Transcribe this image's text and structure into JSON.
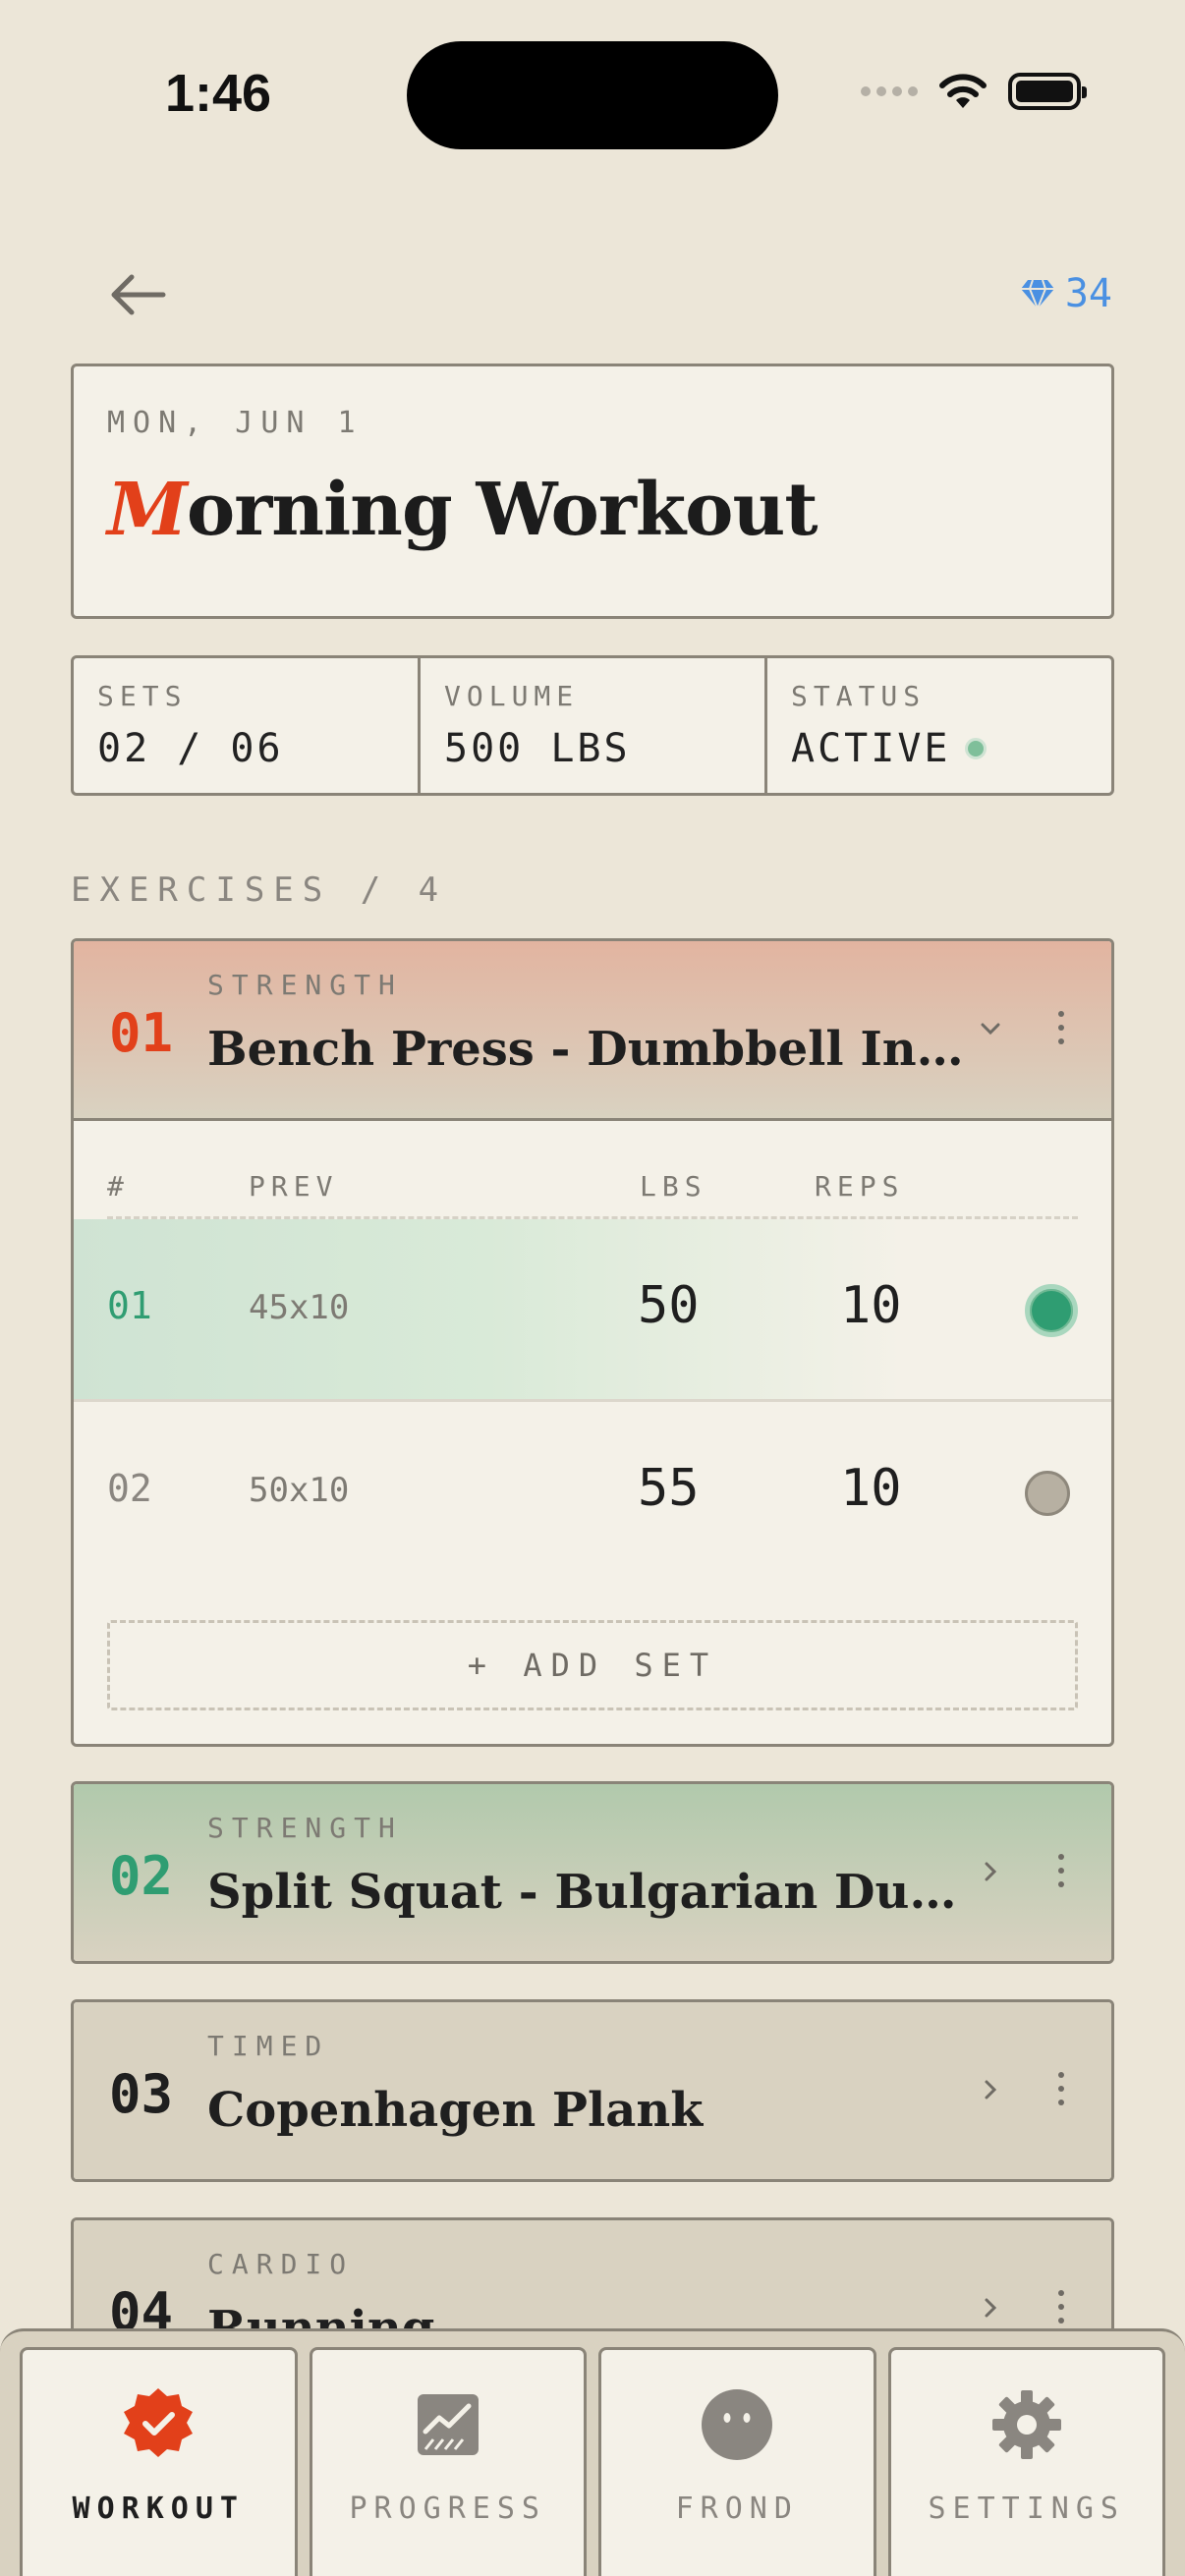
{
  "status_bar": {
    "time": "1:46"
  },
  "header": {
    "gems": "34"
  },
  "workout": {
    "date": "MON, JUN 1",
    "title_initial": "M",
    "title_rest": "orning Workout"
  },
  "stats": [
    {
      "label": "SETS",
      "value": "02 / 06"
    },
    {
      "label": "VOLUME",
      "value": "500 LBS"
    },
    {
      "label": "STATUS",
      "value": "ACTIVE"
    }
  ],
  "exercises_header": "EXERCISES / 4",
  "columns": {
    "idx": "#",
    "prev": "PREV",
    "lbs": "LBS",
    "reps": "REPS"
  },
  "exercises": [
    {
      "num": "01",
      "category": "STRENGTH",
      "name": "Bench Press - Dumbbell Incline",
      "sets": [
        {
          "idx": "01",
          "prev": "45x10",
          "lbs": "50",
          "reps": "10"
        },
        {
          "idx": "02",
          "prev": "50x10",
          "lbs": "55",
          "reps": "10"
        }
      ],
      "add_set": "+ ADD SET"
    },
    {
      "num": "02",
      "category": "STRENGTH",
      "name": "Split Squat - Bulgarian Dumbb…"
    },
    {
      "num": "03",
      "category": "TIMED",
      "name": "Copenhagen Plank"
    },
    {
      "num": "04",
      "category": "CARDIO",
      "name": "Running"
    }
  ],
  "tabs": [
    {
      "label": "WORKOUT",
      "icon": "workout-badge-icon"
    },
    {
      "label": "PROGRESS",
      "icon": "chart-icon"
    },
    {
      "label": "FROND",
      "icon": "face-icon"
    },
    {
      "label": "SETTINGS",
      "icon": "gear-icon"
    }
  ],
  "colors": {
    "accent": "#e2401a",
    "done": "#2f9d72",
    "gem": "#4a90e2",
    "background": "#ece6d8"
  }
}
